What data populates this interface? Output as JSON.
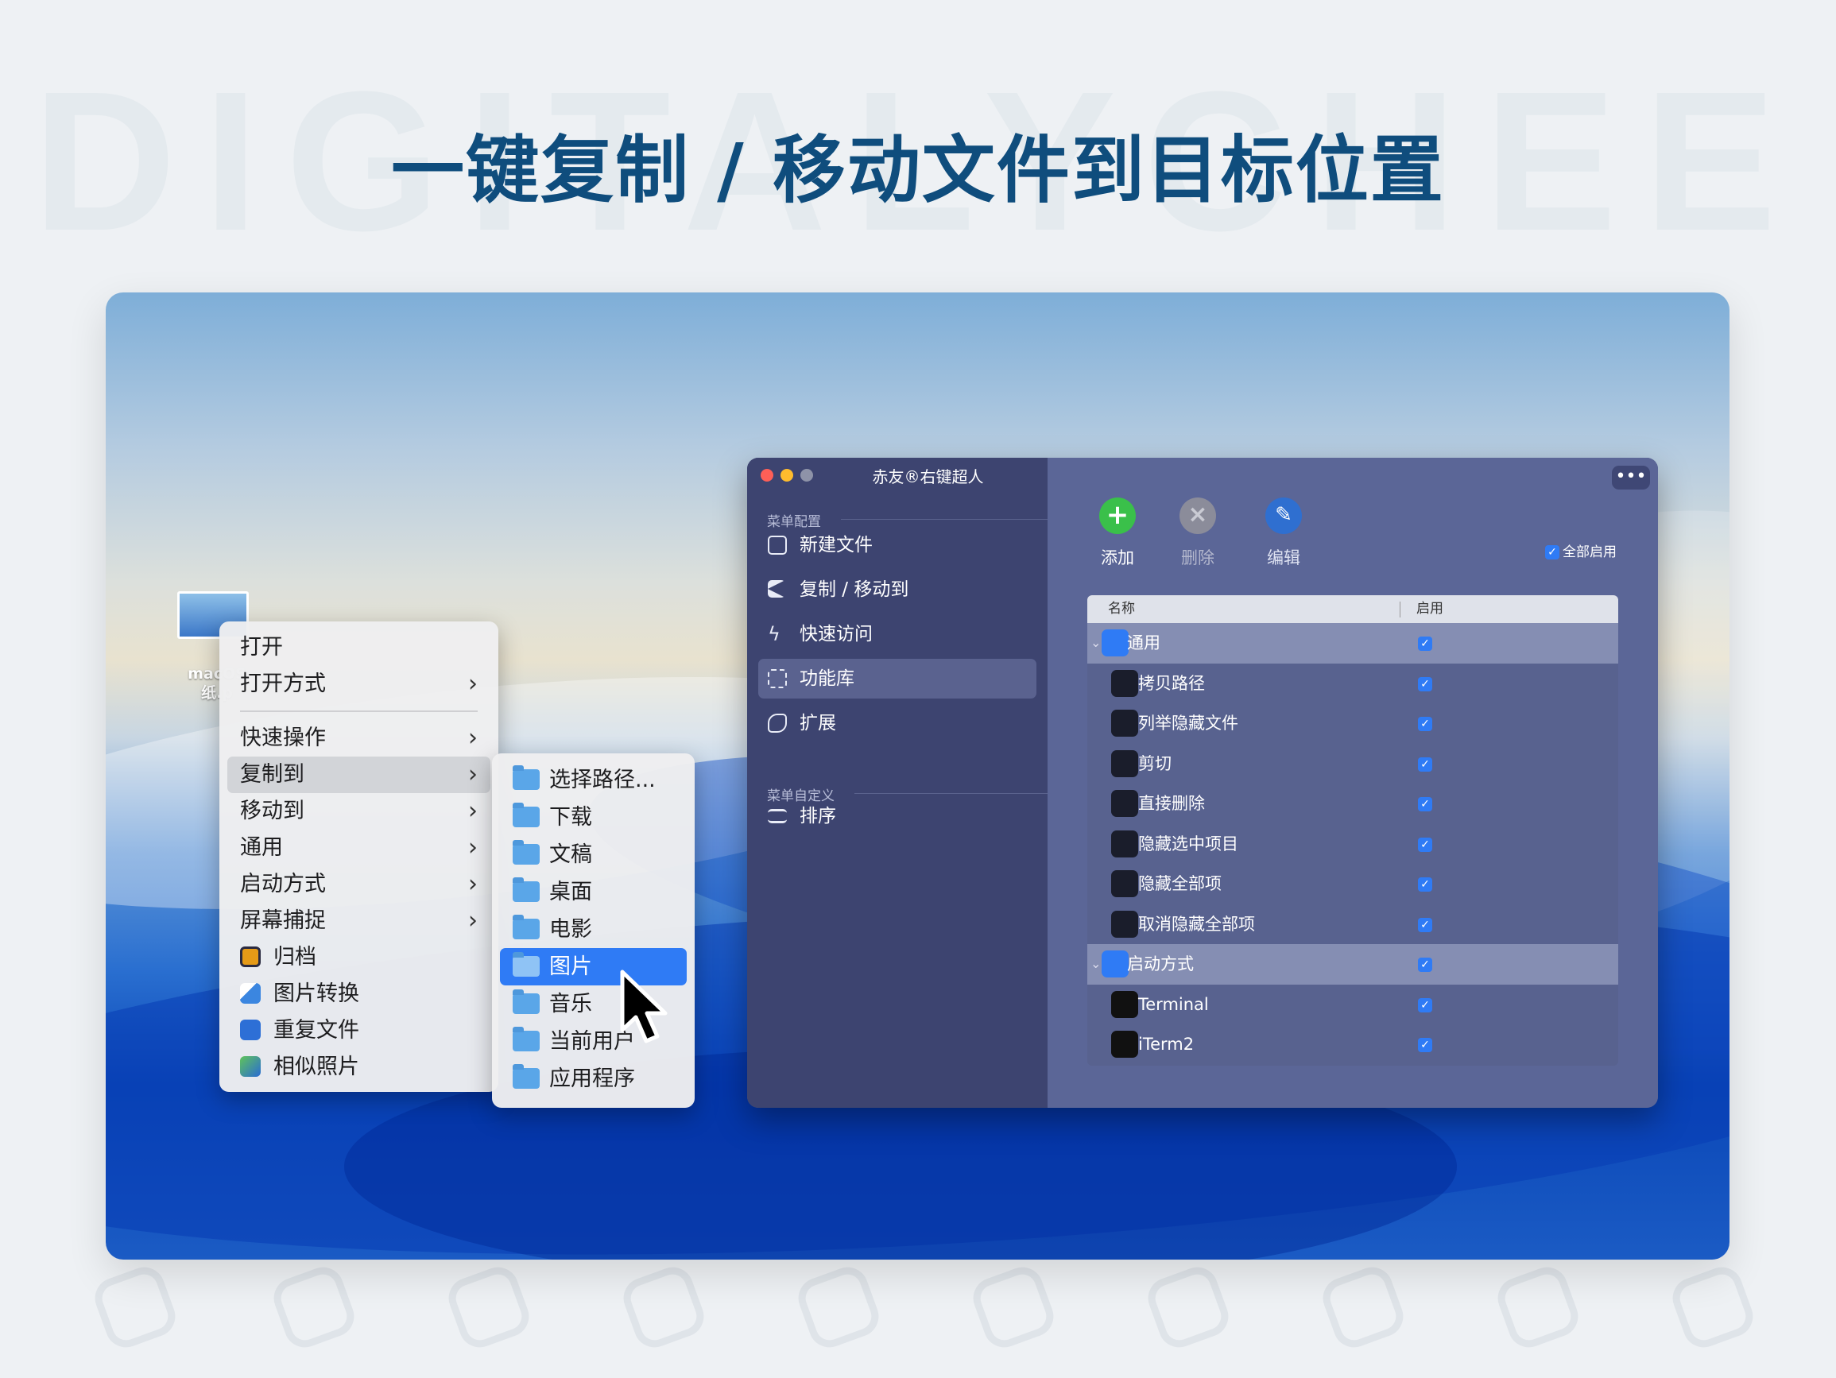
{
  "watermark": "DIGITALYCHEE",
  "headline": "一键复制 / 移动文件到目标位置",
  "desktop": {
    "file_label_line1": "macOS",
    "file_label_line2": "纸.p"
  },
  "context_menu": {
    "items": [
      {
        "label": "打开",
        "chevron": false
      },
      {
        "label": "打开方式",
        "chevron": true
      },
      {
        "label": "快速操作",
        "chevron": true
      },
      {
        "label": "复制到",
        "chevron": true,
        "highlighted": true
      },
      {
        "label": "移动到",
        "chevron": true
      },
      {
        "label": "通用",
        "chevron": true
      },
      {
        "label": "启动方式",
        "chevron": true
      },
      {
        "label": "屏幕捕捉",
        "chevron": true
      },
      {
        "label": "归档",
        "icon": "archive-icon"
      },
      {
        "label": "图片转换",
        "icon": "image-convert-icon"
      },
      {
        "label": "重复文件",
        "icon": "duplicate-file-icon"
      },
      {
        "label": "相似照片",
        "icon": "similar-photo-icon"
      }
    ],
    "chevron_glyph": "›"
  },
  "submenu": {
    "items": [
      "选择路径...",
      "下载",
      "文稿",
      "桌面",
      "电影",
      "图片",
      "音乐",
      "当前用户",
      "应用程序"
    ],
    "selected": "图片"
  },
  "app": {
    "title": "赤友®右键超人",
    "sidebar": {
      "section1": "菜单配置",
      "items": [
        {
          "label": "新建文件",
          "icon": "new-file-icon"
        },
        {
          "label": "复制 / 移动到",
          "icon": "send-icon"
        },
        {
          "label": "快速访问",
          "icon": "lightning-icon"
        },
        {
          "label": "功能库",
          "icon": "grid-icon",
          "active": true
        },
        {
          "label": "扩展",
          "icon": "puzzle-icon"
        }
      ],
      "section2": "菜单自定义",
      "items2": [
        {
          "label": "排序",
          "icon": "sort-icon"
        }
      ]
    },
    "toolbar": {
      "add": "添加",
      "delete": "删除",
      "edit": "编辑",
      "more": "•••",
      "enable_all": "全部启用"
    },
    "table": {
      "col_name": "名称",
      "col_enabled": "启用",
      "rows": [
        {
          "label": "通用",
          "group": true,
          "enabled": true,
          "color": "#2f7bf5"
        },
        {
          "label": "拷贝路径",
          "enabled": true,
          "color": "#1a1d2b"
        },
        {
          "label": "列举隐藏文件",
          "enabled": true,
          "color": "#1a1d2b"
        },
        {
          "label": "剪切",
          "enabled": true,
          "color": "#1a1d2b"
        },
        {
          "label": "直接删除",
          "enabled": true,
          "color": "#1a1d2b"
        },
        {
          "label": "隐藏选中项目",
          "enabled": true,
          "color": "#1a1d2b"
        },
        {
          "label": "隐藏全部项",
          "enabled": true,
          "color": "#1a1d2b"
        },
        {
          "label": "取消隐藏全部项",
          "enabled": true,
          "color": "#1a1d2b"
        },
        {
          "label": "启动方式",
          "group": true,
          "enabled": true,
          "color": "#2f7bf5"
        },
        {
          "label": "Terminal",
          "enabled": true,
          "color": "#111"
        },
        {
          "label": "iTerm2",
          "enabled": true,
          "color": "#111"
        }
      ]
    },
    "check_glyph": "✓"
  },
  "colors": {
    "accent": "#2f7bf5",
    "headline": "#0f4d7d",
    "sidebar": "#3d4470",
    "main": "#5b6697"
  }
}
